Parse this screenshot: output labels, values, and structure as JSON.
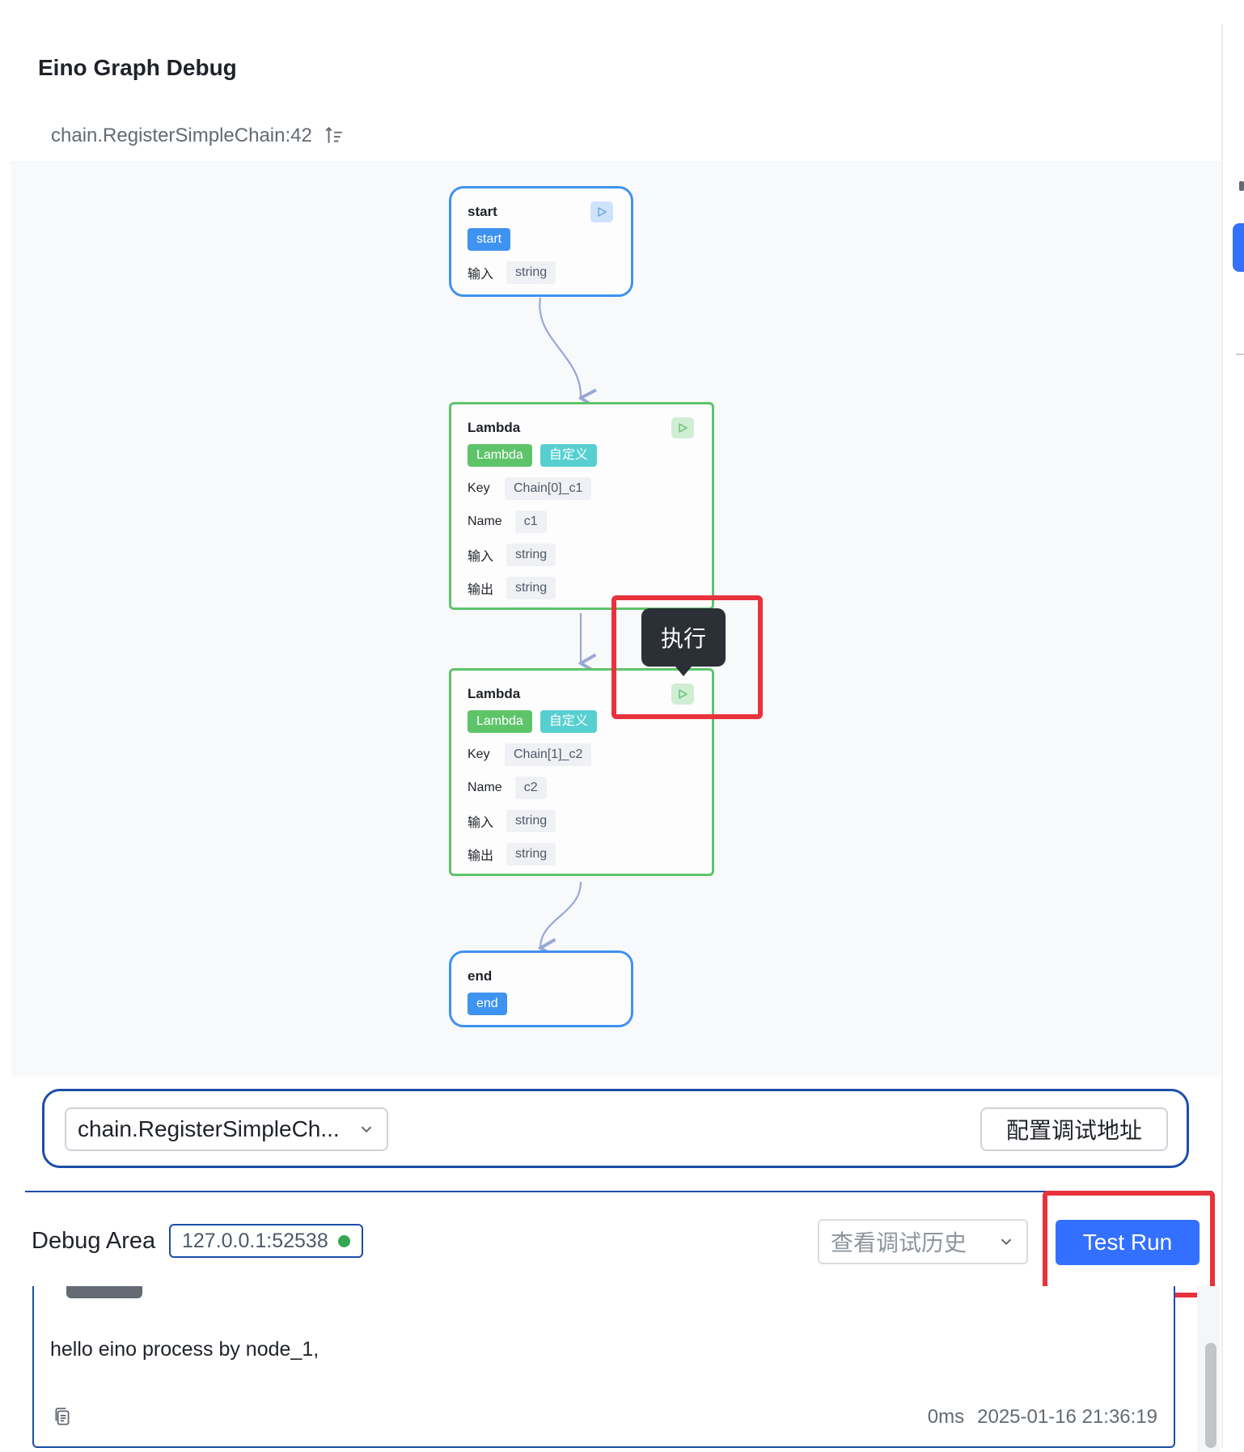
{
  "page": {
    "title": "Eino Graph Debug"
  },
  "breadcrumb": {
    "text": "chain.RegisterSimpleChain:42",
    "icon": "sort-icon"
  },
  "graph": {
    "start": {
      "title": "start",
      "tag": "start",
      "input_label": "输入",
      "input_type": "string"
    },
    "lambda1": {
      "title": "Lambda",
      "tag1": "Lambda",
      "tag2": "自定义",
      "key_label": "Key",
      "key": "Chain[0]_c1",
      "name_label": "Name",
      "name": "c1",
      "input_label": "输入",
      "input_type": "string",
      "output_label": "输出",
      "output_type": "string"
    },
    "lambda2": {
      "title": "Lambda",
      "tag1": "Lambda",
      "tag2": "自定义",
      "key_label": "Key",
      "key": "Chain[1]_c2",
      "name_label": "Name",
      "name": "c2",
      "input_label": "输入",
      "input_type": "string",
      "output_label": "输出",
      "output_type": "string"
    },
    "end": {
      "title": "end",
      "tag": "end"
    },
    "tooltip": "执行"
  },
  "selector": {
    "value": "chain.RegisterSimpleCh...",
    "config_button": "配置调试地址"
  },
  "debug": {
    "label": "Debug Area",
    "address": "127.0.0.1:52538",
    "status_color": "#34a853",
    "history_placeholder": "查看调试历史",
    "test_run": "Test Run"
  },
  "output": {
    "message": "hello eino process by node_1,",
    "duration": "0ms",
    "timestamp": "2025-01-16 21:36:19"
  },
  "colors": {
    "accent": "#3370ff",
    "node_blue": "#3e92f0",
    "node_green": "#5ec46a",
    "highlight_red": "#e8323c"
  }
}
